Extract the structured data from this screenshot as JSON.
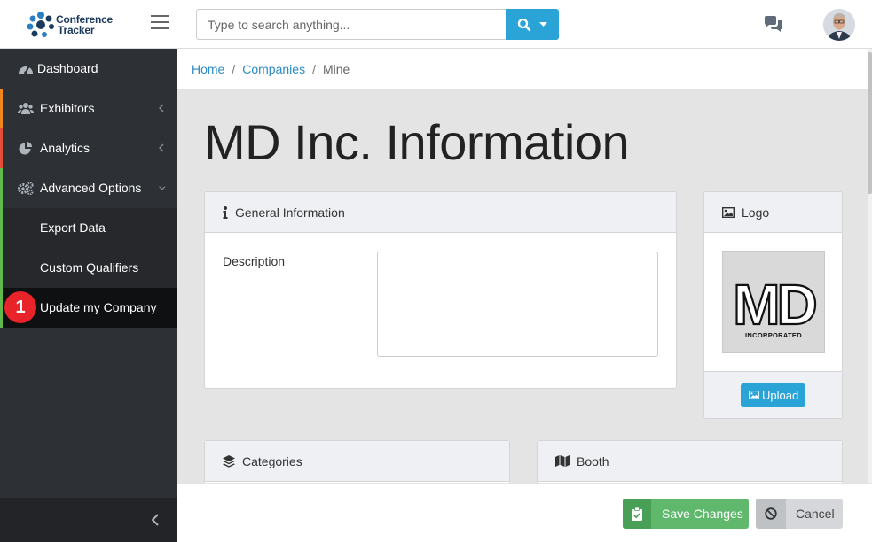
{
  "app": {
    "logo_line1": "Conference",
    "logo_line2": "Tracker",
    "logo_icon": "people-cluster-icon"
  },
  "search": {
    "placeholder": "Type to search anything...",
    "icon": "search-icon",
    "dropdown_icon": "caret-down-icon"
  },
  "header": {
    "chat_icon": "comments-icon",
    "avatar_icon": "user-avatar"
  },
  "sidebar": {
    "items": [
      {
        "label": "Dashboard",
        "icon": "tachometer-icon"
      },
      {
        "label": "Exhibitors",
        "icon": "users-icon",
        "chevron": "chevron-left-icon"
      },
      {
        "label": "Analytics",
        "icon": "pie-chart-icon",
        "chevron": "chevron-left-icon"
      },
      {
        "label": "Advanced Options",
        "icon": "cogs-icon",
        "chevron": "chevron-down-icon"
      },
      {
        "label": "Export Data"
      },
      {
        "label": "Custom Qualifiers"
      },
      {
        "label": "Update my Company",
        "badge": "1"
      }
    ],
    "collapse_icon": "chevron-left-icon"
  },
  "breadcrumb": {
    "items": [
      "Home",
      "Companies",
      "Mine"
    ]
  },
  "page": {
    "title": "MD Inc. Information"
  },
  "general_panel": {
    "title": "General Information",
    "icon": "info-icon",
    "description_label": "Description",
    "description_value": ""
  },
  "logo_panel": {
    "title": "Logo",
    "icon": "image-icon",
    "logo_text_main": "MD",
    "logo_text_sub": "INCORPORATED",
    "upload_label": "Upload",
    "upload_icon": "image-icon"
  },
  "categories_panel": {
    "title": "Categories",
    "icon": "layers-icon"
  },
  "booth_panel": {
    "title": "Booth",
    "icon": "map-icon"
  },
  "actions": {
    "save_label": "Save Changes",
    "save_icon": "clipboard-check-icon",
    "cancel_label": "Cancel",
    "cancel_icon": "ban-icon"
  },
  "colors": {
    "accent": "#2aa3d6",
    "sidebar_bg": "#2d3035",
    "exhibitors_marker": "#f0861c",
    "analytics_marker": "#e64c3c",
    "advanced_marker": "#5fb94b",
    "badge": "#e8242a",
    "save_button": "#5fb86b",
    "cancel_button": "#d5d7da"
  }
}
